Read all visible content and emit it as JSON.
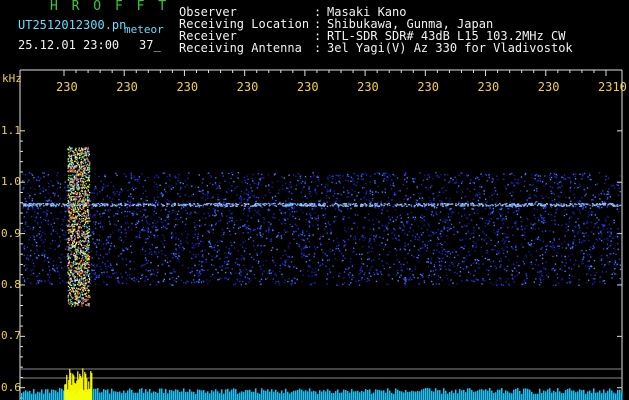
{
  "header": {
    "app_title": "H R O F F T",
    "filename": "UT2512012300.pn",
    "meteor_label": "meteor",
    "datetime": "25.12.01 23:00",
    "count": "37_"
  },
  "meta": [
    {
      "label": "Observer",
      "value": "Masaki Kano"
    },
    {
      "label": "Receiving Location",
      "value": "Shibukawa, Gunma, Japan"
    },
    {
      "label": "Receiver",
      "value": "RTL-SDR SDR# 43dB L15 103.2MHz CW"
    },
    {
      "label": "Receiving Antenna",
      "value": "3el Yagi(V) Az 330 for Vladivostok"
    }
  ],
  "chart_data": {
    "type": "heatmap",
    "y_unit_label": "kHz",
    "y_tick_labels": [
      "1.1",
      "1.0",
      "0.9",
      "0.8",
      "0.7",
      "0.6"
    ],
    "y_ticks": [
      1.1,
      1.0,
      0.9,
      0.8,
      0.7,
      0.6
    ],
    "ylim": [
      0.58,
      1.16
    ],
    "x_tick_labels": [
      "230",
      "230",
      "230",
      "230",
      "230",
      "230",
      "230",
      "230",
      "230",
      "2310"
    ],
    "band_khz": [
      0.8,
      1.02
    ],
    "carrier_khz": 0.957,
    "meteor_echo_x_fraction": 0.09,
    "colors": {
      "axis": "#e0e0e0",
      "tick_label": "#f0d040",
      "header_label": "#f2f2f2",
      "filename": "#66ddff",
      "app_title": "#33cc33",
      "signal_low": "#1a22cc",
      "signal_high": "#ff3030",
      "bottom_bars": "#00ccff",
      "meteor_bars": "#ffff00"
    }
  }
}
